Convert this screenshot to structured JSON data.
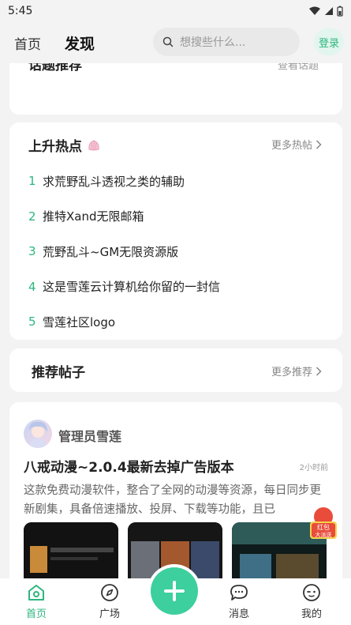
{
  "status": {
    "time": "5:45"
  },
  "header": {
    "tabs": [
      {
        "label": "首页"
      },
      {
        "label": "发现"
      }
    ],
    "search_placeholder": "想搜些什么...",
    "login_label": "登录"
  },
  "top_card": {
    "title": "话题推荐",
    "more": "查看话题"
  },
  "hot": {
    "title": "上升热点",
    "more": "更多热帖",
    "items": [
      {
        "rank": "1",
        "text": "求荒野乱斗透视之类的辅助"
      },
      {
        "rank": "2",
        "text": "推特Xand无限邮箱"
      },
      {
        "rank": "3",
        "text": "荒野乱斗~GM无限资源版"
      },
      {
        "rank": "4",
        "text": "这是雪莲云计算机给你留的一封信"
      },
      {
        "rank": "5",
        "text": "雪莲社区logo"
      }
    ]
  },
  "recommend": {
    "title": "推荐帖子",
    "more": "更多推荐"
  },
  "post": {
    "author": "管理员雪莲",
    "title": "八戒动漫~2.0.4最新去掉广告版本",
    "time": "2小时前",
    "body": "这款免费动漫软件，整合了全网的动漫等资源，每日同步更新剧集，具备倍速播放、投屏、下载等功能，且已"
  },
  "redpack": {
    "line1": "红包",
    "line2": "大派送"
  },
  "nav": [
    {
      "label": "首页",
      "icon": "home-icon",
      "active": true
    },
    {
      "label": "广场",
      "icon": "compass-icon",
      "active": false
    },
    {
      "label": "消息",
      "icon": "chat-icon",
      "active": false
    },
    {
      "label": "我的",
      "icon": "profile-icon",
      "active": false
    }
  ],
  "colors": {
    "accent": "#2cb67d",
    "fab": "#3dcf9e",
    "background": "#f3f3f3"
  }
}
